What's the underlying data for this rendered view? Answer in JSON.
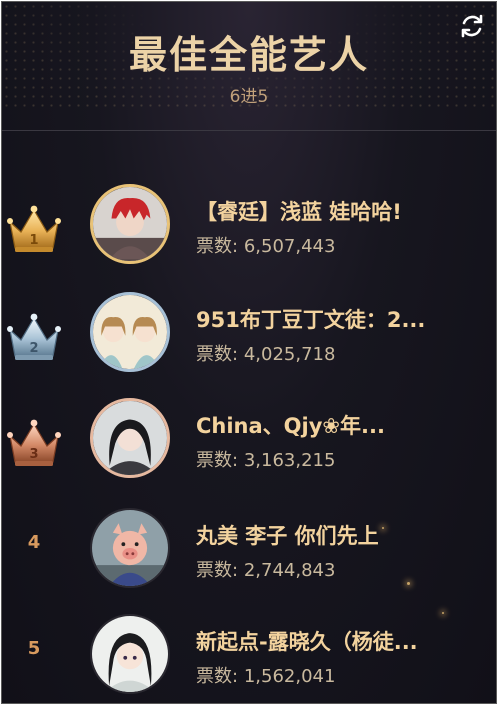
{
  "header": {
    "title": "最佳全能艺人",
    "subtitle": "6进5"
  },
  "ranking": [
    {
      "rank": "1",
      "name": "【睿廷】浅蓝 娃哈哈!",
      "votes_label": "票数:",
      "votes": "6,507,443"
    },
    {
      "rank": "2",
      "name": "951布丁豆丁文徒：2...",
      "votes_label": "票数:",
      "votes": "4,025,718"
    },
    {
      "rank": "3",
      "name": "China、Qjy❀年...",
      "votes_label": "票数:",
      "votes": "3,163,215"
    },
    {
      "rank": "4",
      "name": "丸美 李子 你们先上",
      "votes_label": "票数:",
      "votes": "2,744,843"
    },
    {
      "rank": "5",
      "name": "新起点-露晓久（杨徒...",
      "votes_label": "票数:",
      "votes": "1,562,041"
    }
  ],
  "colors": {
    "gold": "#e8b659",
    "silver": "#b7cfe0",
    "bronze": "#d48a68",
    "title": "#ecd3a7",
    "name": "#f3d39e"
  },
  "icons": {
    "refresh": "refresh-icon",
    "crown": "crown-icon"
  }
}
